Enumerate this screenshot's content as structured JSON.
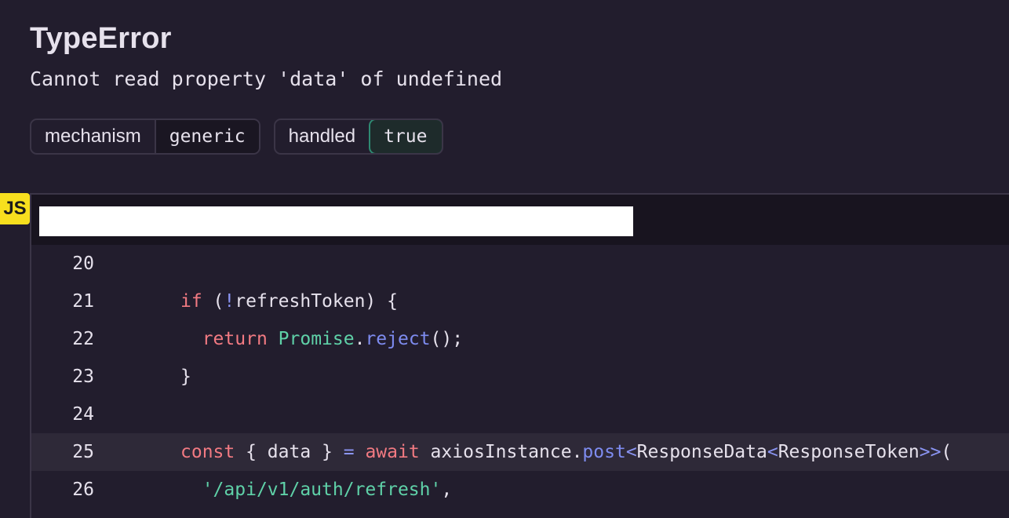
{
  "error": {
    "type": "TypeError",
    "message": "Cannot read property 'data' of undefined"
  },
  "tags": [
    {
      "key": "mechanism",
      "value": "generic"
    },
    {
      "key": "handled",
      "value": "true"
    }
  ],
  "frame": {
    "platform_badge": "JS",
    "lines": [
      {
        "number": "20",
        "indent": "",
        "tokens": []
      },
      {
        "number": "21",
        "indent": "",
        "tokens": [
          {
            "t": "if",
            "c": "kw"
          },
          {
            "t": " (",
            "c": ""
          },
          {
            "t": "!",
            "c": "op"
          },
          {
            "t": "refreshToken) {",
            "c": ""
          }
        ]
      },
      {
        "number": "22",
        "indent": "  ",
        "tokens": [
          {
            "t": "return",
            "c": "kw"
          },
          {
            "t": " ",
            "c": ""
          },
          {
            "t": "Promise",
            "c": "cls"
          },
          {
            "t": ".",
            "c": ""
          },
          {
            "t": "reject",
            "c": "fn"
          },
          {
            "t": "();",
            "c": ""
          }
        ]
      },
      {
        "number": "23",
        "indent": "",
        "tokens": [
          {
            "t": "}",
            "c": ""
          }
        ]
      },
      {
        "number": "24",
        "indent": "",
        "tokens": []
      },
      {
        "number": "25",
        "indent": "",
        "active": true,
        "tokens": [
          {
            "t": "const",
            "c": "kw"
          },
          {
            "t": " { data } ",
            "c": ""
          },
          {
            "t": "=",
            "c": "op"
          },
          {
            "t": " ",
            "c": ""
          },
          {
            "t": "await",
            "c": "kw"
          },
          {
            "t": " axiosInstance.",
            "c": ""
          },
          {
            "t": "post",
            "c": "fn"
          },
          {
            "t": "<",
            "c": "op"
          },
          {
            "t": "ResponseData",
            "c": ""
          },
          {
            "t": "<",
            "c": "op"
          },
          {
            "t": "ResponseToken",
            "c": ""
          },
          {
            "t": ">>",
            "c": "op"
          },
          {
            "t": "(",
            "c": ""
          }
        ]
      },
      {
        "number": "26",
        "indent": "  ",
        "tokens": [
          {
            "t": "'/api/v1/auth/refresh'",
            "c": "str"
          },
          {
            "t": ",",
            "c": ""
          }
        ]
      }
    ]
  }
}
